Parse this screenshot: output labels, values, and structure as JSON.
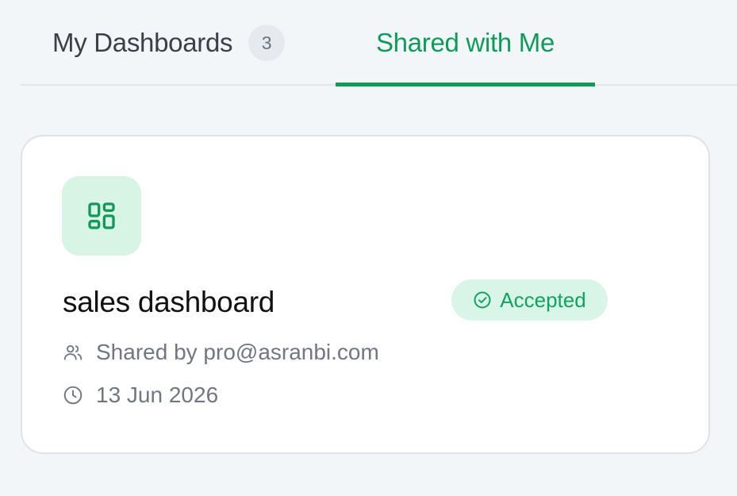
{
  "tabs": {
    "mine": {
      "label": "My Dashboards",
      "count": "3"
    },
    "shared": {
      "label": "Shared with Me"
    }
  },
  "card": {
    "title": "sales dashboard",
    "status": "Accepted",
    "shared_by": "Shared by pro@asranbi.com",
    "date": "13 Jun 2026",
    "icon": "dashboard-icon"
  },
  "colors": {
    "accent": "#0f9a5a",
    "accent_soft": "#d7f4e5",
    "background": "#f3f6f9",
    "muted_text": "#707782"
  }
}
